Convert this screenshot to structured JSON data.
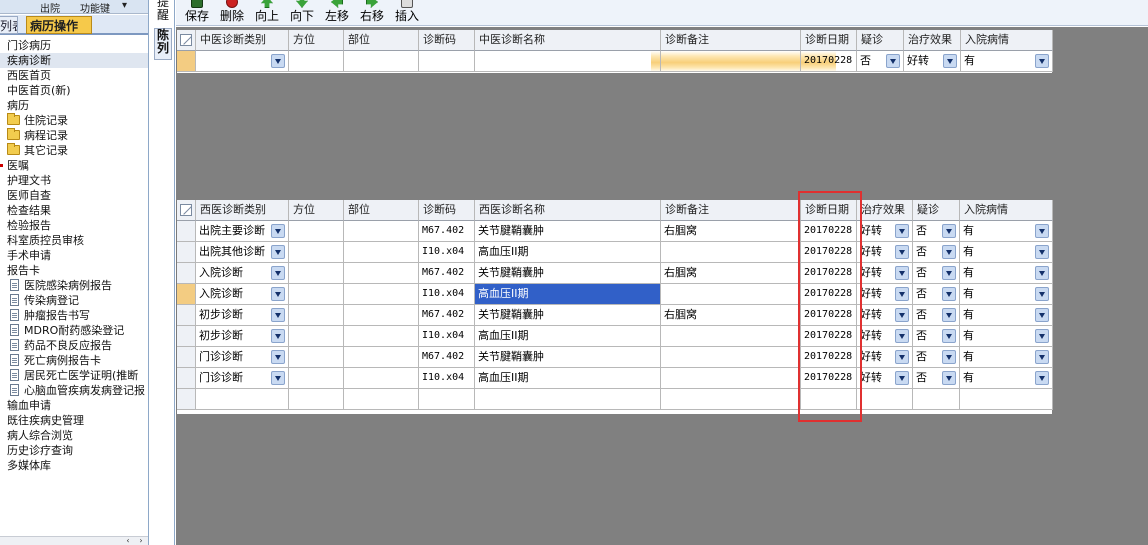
{
  "sidebar_top": {
    "left_text": "",
    "mid_text": "出院",
    "right_text": "功能键"
  },
  "sidebar_tabs": {
    "list": "列表",
    "record": "病历操作"
  },
  "tree": [
    {
      "label": "门诊病历",
      "indent": 0,
      "icon": "none"
    },
    {
      "label": "疾病诊断",
      "indent": 0,
      "icon": "none",
      "selected": true
    },
    {
      "label": "西医首页",
      "indent": 0,
      "icon": "none"
    },
    {
      "label": "中医首页(新)",
      "indent": 0,
      "icon": "none"
    },
    {
      "label": "病历",
      "indent": 0,
      "icon": "none"
    },
    {
      "label": "住院记录",
      "indent": 1,
      "icon": "folder"
    },
    {
      "label": "病程记录",
      "indent": 1,
      "icon": "folder"
    },
    {
      "label": "其它记录",
      "indent": 1,
      "icon": "folder"
    },
    {
      "label": "医嘱",
      "indent": 0,
      "icon": "none"
    },
    {
      "label": "护理文书",
      "indent": 0,
      "icon": "none"
    },
    {
      "label": "医师自查",
      "indent": 0,
      "icon": "none"
    },
    {
      "label": "检查结果",
      "indent": 0,
      "icon": "none"
    },
    {
      "label": "检验报告",
      "indent": 0,
      "icon": "none"
    },
    {
      "label": "科室质控员审核",
      "indent": 0,
      "icon": "none"
    },
    {
      "label": "手术申请",
      "indent": 0,
      "icon": "none"
    },
    {
      "label": "报告卡",
      "indent": 0,
      "icon": "none"
    },
    {
      "label": "医院感染病例报告",
      "indent": 1,
      "icon": "doc"
    },
    {
      "label": "传染病登记",
      "indent": 1,
      "icon": "doc"
    },
    {
      "label": "肿瘤报告书写",
      "indent": 1,
      "icon": "doc"
    },
    {
      "label": "MDRO耐药感染登记",
      "indent": 1,
      "icon": "doc"
    },
    {
      "label": "药品不良反应报告",
      "indent": 1,
      "icon": "doc"
    },
    {
      "label": "死亡病例报告卡",
      "indent": 1,
      "icon": "doc"
    },
    {
      "label": "居民死亡医学证明(推断",
      "indent": 1,
      "icon": "doc"
    },
    {
      "label": "心脑血管疾病发病登记报",
      "indent": 1,
      "icon": "doc"
    },
    {
      "label": "输血申请",
      "indent": 0,
      "icon": "none"
    },
    {
      "label": "既往疾病史管理",
      "indent": 0,
      "icon": "none"
    },
    {
      "label": "病人综合浏览",
      "indent": 0,
      "icon": "none"
    },
    {
      "label": "历史诊疗查询",
      "indent": 0,
      "icon": "none"
    },
    {
      "label": "多媒体库",
      "indent": 0,
      "icon": "none"
    }
  ],
  "vertical_tabs": {
    "tip": "提醒",
    "statement": "陈列"
  },
  "toolbar": {
    "save": "保存",
    "delete": "删除",
    "up": "向上",
    "down": "向下",
    "left": "左移",
    "right": "右移",
    "insert": "插入"
  },
  "tcm_grid": {
    "headers": [
      "中医诊断类别",
      "方位",
      "部位",
      "诊断码",
      "中医诊断名称",
      "诊断备注",
      "诊断日期",
      "疑诊",
      "治疗效果",
      "入院病情"
    ],
    "rows": [
      {
        "category": "",
        "position": "",
        "site": "",
        "code": "",
        "name": "",
        "remark": "",
        "date": "20170228",
        "suspect": "否",
        "effect": "好转",
        "condition": "有"
      }
    ]
  },
  "wm_grid": {
    "headers": [
      "西医诊断类别",
      "方位",
      "部位",
      "诊断码",
      "西医诊断名称",
      "诊断备注",
      "诊断日期",
      "治疗效果",
      "疑诊",
      "入院病情"
    ],
    "rows": [
      {
        "category": "出院主要诊断",
        "position": "",
        "site": "",
        "code": "M67.402",
        "name": "关节腱鞘囊肿",
        "remark": "右腘窝",
        "date": "20170228",
        "effect": "好转",
        "suspect": "否",
        "condition": "有"
      },
      {
        "category": "出院其他诊断",
        "position": "",
        "site": "",
        "code": "I10.x04",
        "name": "高血压II期",
        "remark": "",
        "date": "20170228",
        "effect": "好转",
        "suspect": "否",
        "condition": "有"
      },
      {
        "category": "入院诊断",
        "position": "",
        "site": "",
        "code": "M67.402",
        "name": "关节腱鞘囊肿",
        "remark": "右腘窝",
        "date": "20170228",
        "effect": "好转",
        "suspect": "否",
        "condition": "有"
      },
      {
        "category": "入院诊断",
        "position": "",
        "site": "",
        "code": "I10.x04",
        "name": "高血压II期",
        "remark": "",
        "date": "20170228",
        "effect": "好转",
        "suspect": "否",
        "condition": "有"
      },
      {
        "category": "初步诊断",
        "position": "",
        "site": "",
        "code": "M67.402",
        "name": "关节腱鞘囊肿",
        "remark": "右腘窝",
        "date": "20170228",
        "effect": "好转",
        "suspect": "否",
        "condition": "有"
      },
      {
        "category": "初步诊断",
        "position": "",
        "site": "",
        "code": "I10.x04",
        "name": "高血压II期",
        "remark": "",
        "date": "20170228",
        "effect": "好转",
        "suspect": "否",
        "condition": "有"
      },
      {
        "category": "门诊诊断",
        "position": "",
        "site": "",
        "code": "M67.402",
        "name": "关节腱鞘囊肿",
        "remark": "",
        "date": "20170228",
        "effect": "好转",
        "suspect": "否",
        "condition": "有"
      },
      {
        "category": "门诊诊断",
        "position": "",
        "site": "",
        "code": "I10.x04",
        "name": "高血压II期",
        "remark": "",
        "date": "20170228",
        "effect": "好转",
        "suspect": "否",
        "condition": "有"
      }
    ]
  },
  "colors": {
    "highlight_box": "#e03030",
    "selected_cell": "#3160c8",
    "current_row_marker": "#f3cc82",
    "record_tab": "#f6c94a"
  }
}
